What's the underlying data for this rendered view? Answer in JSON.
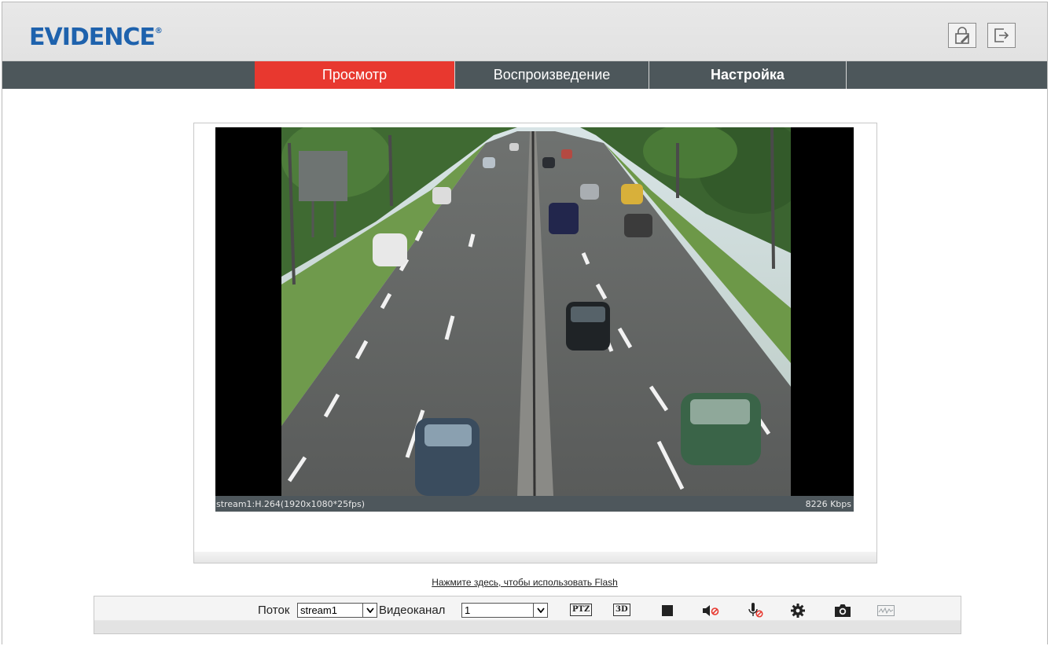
{
  "app": {
    "logo_text": "EVIDENCE",
    "logo_mark": "®",
    "brand_color": "#1e62ad",
    "accent_color": "#e8382f"
  },
  "header": {
    "buttons": [
      {
        "icon": "lock-edit-icon"
      },
      {
        "icon": "logout-icon"
      }
    ]
  },
  "nav": {
    "tabs": [
      {
        "label": "Просмотр",
        "active": true
      },
      {
        "label": "Воспроизведение",
        "active": false
      },
      {
        "label": "Настройка",
        "active": false
      }
    ]
  },
  "video": {
    "stream_info": "stream1:H.264(1920x1080*25fps)",
    "bitrate": "8226 Kbps"
  },
  "flash_link": "Нажмите здесь, чтобы использовать Flash",
  "toolbar": {
    "stream_label": "Поток",
    "stream_value": "stream1",
    "channel_label": "Видеоканал",
    "channel_value": "1",
    "ptz_label": "PTZ",
    "three_d_label": "3D",
    "icons": [
      "stop-icon",
      "mute-icon",
      "microphone-off-icon",
      "settings-gear-icon",
      "camera-snapshot-icon",
      "waveform-icon"
    ]
  }
}
